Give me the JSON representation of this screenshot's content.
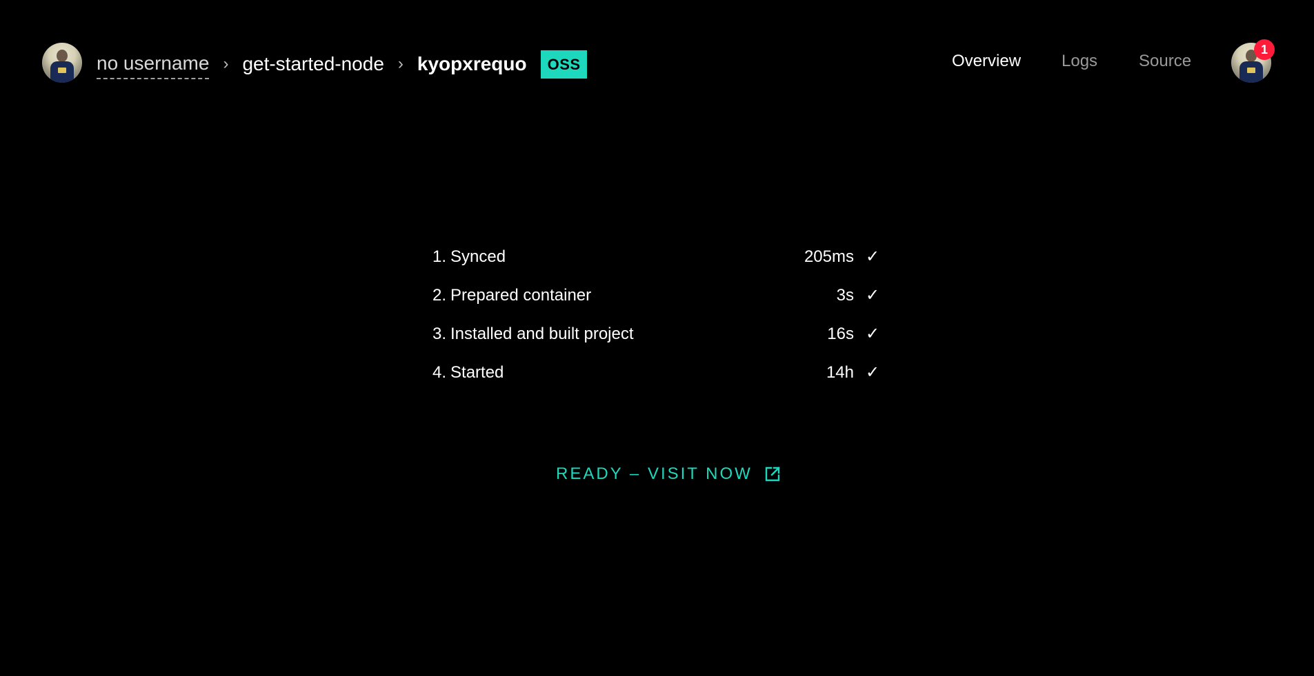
{
  "header": {
    "user_avatar_alt": "user avatar",
    "breadcrumb": {
      "user": "no username",
      "separator": "›",
      "project": "get-started-node",
      "deployment": "kyopxrequo",
      "badge": "OSS"
    },
    "nav": {
      "overview": "Overview",
      "logs": "Logs",
      "source": "Source",
      "active": "overview"
    },
    "notifications": "1"
  },
  "steps": [
    {
      "index": "1.",
      "label": "Synced",
      "duration": "205ms",
      "status_icon": "✓"
    },
    {
      "index": "2.",
      "label": "Prepared container",
      "duration": "3s",
      "status_icon": "✓"
    },
    {
      "index": "3.",
      "label": "Installed and built project",
      "duration": "16s",
      "status_icon": "✓"
    },
    {
      "index": "4.",
      "label": "Started",
      "duration": "14h",
      "status_icon": "✓"
    }
  ],
  "cta": {
    "label": "READY – VISIT NOW",
    "icon": "external-link-icon"
  },
  "colors": {
    "background": "#000000",
    "accent": "#1ed8bd",
    "notification": "#ff1b3a",
    "muted_nav": "#9a9a9a"
  }
}
